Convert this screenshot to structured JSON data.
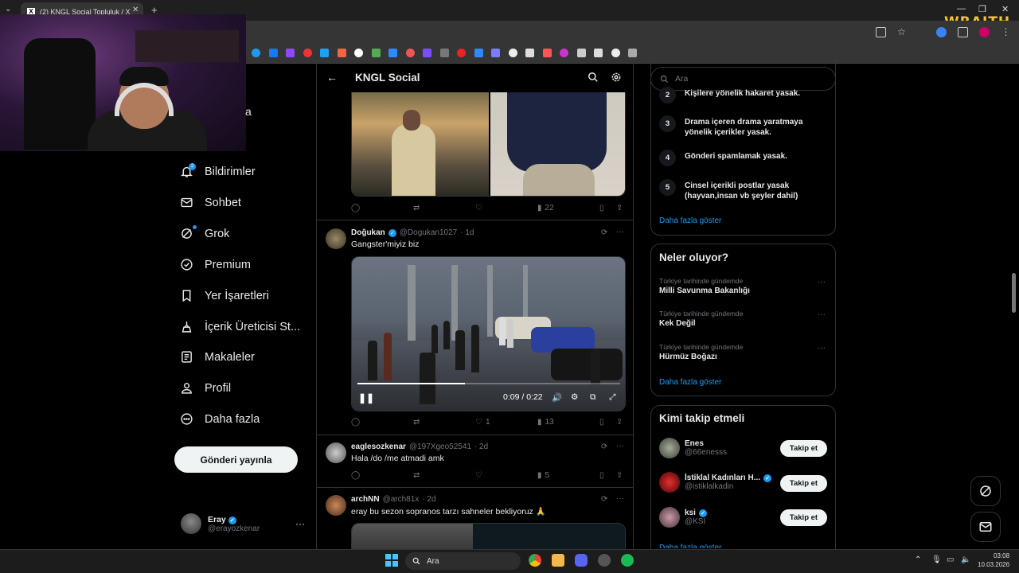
{
  "browser": {
    "tab_title": "(2) KNGL Social Topluluk / X",
    "tab_list_icon": "chevron-down-icon",
    "new_tab": "+",
    "close": "✕",
    "brand_overlay": "WRAITH"
  },
  "nav": {
    "partial_label": "a",
    "items": [
      {
        "label": "Bildirimler",
        "icon": "bell-icon",
        "badge": "2"
      },
      {
        "label": "Sohbet",
        "icon": "mail-icon"
      },
      {
        "label": "Grok",
        "icon": "grok-icon"
      },
      {
        "label": "Premium",
        "icon": "premium-icon"
      },
      {
        "label": "Yer İşaretleri",
        "icon": "bookmark-icon"
      },
      {
        "label": "İçerik Üreticisi St...",
        "icon": "creator-icon"
      },
      {
        "label": "Makaleler",
        "icon": "article-icon"
      },
      {
        "label": "Profil",
        "icon": "profile-icon"
      },
      {
        "label": "Daha fazla",
        "icon": "more-icon"
      }
    ],
    "post_button": "Gönderi yayınla",
    "account": {
      "name": "Eray",
      "handle": "@erayozkenar",
      "more": "···"
    }
  },
  "timeline": {
    "title": "KNGL Social",
    "tweets": [
      {
        "views": "22"
      },
      {
        "name": "Doğukan",
        "handle": "@Dogukan1027",
        "time": "· 1d",
        "text": "Gangster'miyiz biz",
        "video_time": "0:09 / 0:22",
        "video_progress": 0.41,
        "likes": "1",
        "views": "13"
      },
      {
        "name": "eaglesozkenar",
        "handle": "@197Xgeo52541",
        "time": "· 2d",
        "text": "Hala /do /me atmadi amk",
        "views": "5"
      },
      {
        "name": "archNN",
        "handle": "@arch81x",
        "time": "· 2d",
        "text": "eray bu sezon sopranos tarzı sahneler bekliyoruz 🙏"
      }
    ]
  },
  "right": {
    "search_placeholder": "Ara",
    "rules": [
      {
        "num": "2",
        "text": "Kişilere yönelik hakaret yasak."
      },
      {
        "num": "3",
        "text": "Drama içeren drama yaratmaya yönelik içerikler yasak."
      },
      {
        "num": "4",
        "text": "Gönderi spamlamak yasak."
      },
      {
        "num": "5",
        "text": "Cinsel içerikli postlar yasak (hayvan,insan vb şeyler dahil)"
      }
    ],
    "show_more": "Daha fazla göster",
    "trends_title": "Neler oluyor?",
    "trends": [
      {
        "context": "Türkiye tarihinde gündemde",
        "name": "Milli Savunma Bakanlığı"
      },
      {
        "context": "Türkiye tarihinde gündemde",
        "name": "Kek Değil"
      },
      {
        "context": "Türkiye tarihinde gündemde",
        "name": "Hürmüz Boğazı"
      }
    ],
    "wtf_title": "Kimi takip etmeli",
    "wtf": [
      {
        "name": "Enes",
        "handle": "@66enesss",
        "verified": false
      },
      {
        "name": "İstiklal Kadınları H...",
        "handle": "@istiklalkadin",
        "verified": true
      },
      {
        "name": "ksi",
        "handle": "@KSI",
        "verified": true
      }
    ],
    "follow_label": "Takip et"
  },
  "taskbar": {
    "search": "Ara",
    "time": "03:08",
    "date": "10.03.2026"
  },
  "colors": {
    "accent": "#1d9bf0",
    "border": "#2f3336",
    "muted": "#71767b"
  }
}
